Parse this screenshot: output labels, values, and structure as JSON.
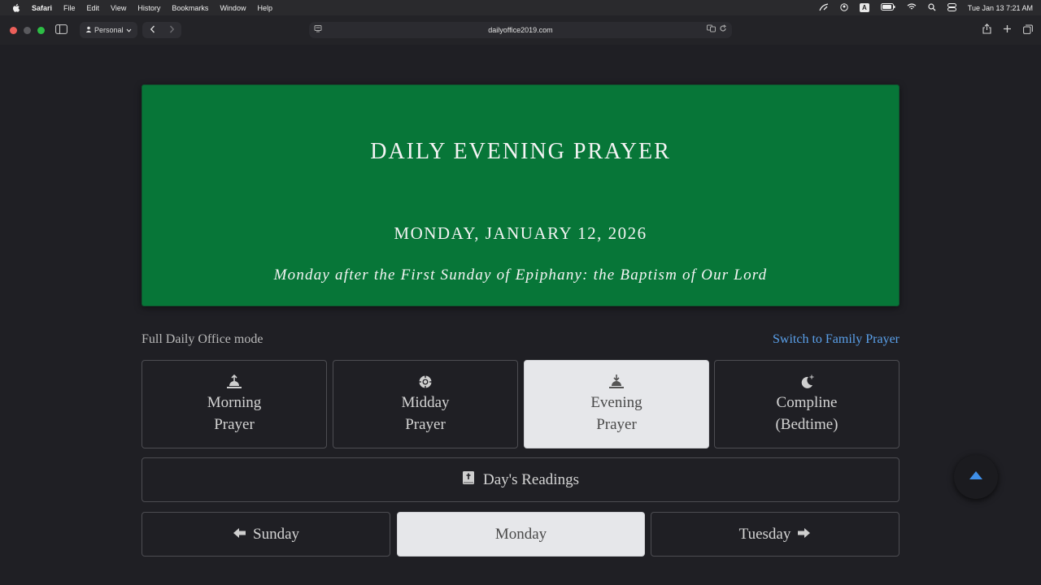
{
  "menubar": {
    "app": "Safari",
    "items": [
      "File",
      "Edit",
      "View",
      "History",
      "Bookmarks",
      "Window",
      "Help"
    ],
    "clock": "Tue Jan 13  7:21 AM",
    "input_badge": "A"
  },
  "toolbar": {
    "profile": "Personal",
    "url": "dailyoffice2019.com"
  },
  "banner": {
    "title": "DAILY EVENING PRAYER",
    "date": "MONDAY, JANUARY 12, 2026",
    "subtitle": "Monday after the First Sunday of Epiphany: the Baptism of Our Lord",
    "color": "#077638"
  },
  "mode": {
    "label": "Full Daily Office mode",
    "switch_link": "Switch to Family Prayer"
  },
  "offices": [
    {
      "line1": "Morning",
      "line2": "Prayer",
      "icon": "sunrise-icon"
    },
    {
      "line1": "Midday",
      "line2": "Prayer",
      "icon": "sun-icon"
    },
    {
      "line1": "Evening",
      "line2": "Prayer",
      "icon": "sunset-icon",
      "active": true
    },
    {
      "line1": "Compline",
      "line2": "(Bedtime)",
      "icon": "moon-icon"
    }
  ],
  "readings": {
    "label": "Day's Readings",
    "icon": "bible-icon"
  },
  "days": {
    "prev": "Sunday",
    "current": "Monday",
    "next": "Tuesday"
  },
  "colors": {
    "accent_link": "#5aa0ea",
    "scroll_top_arrow": "#3f8fe8"
  }
}
